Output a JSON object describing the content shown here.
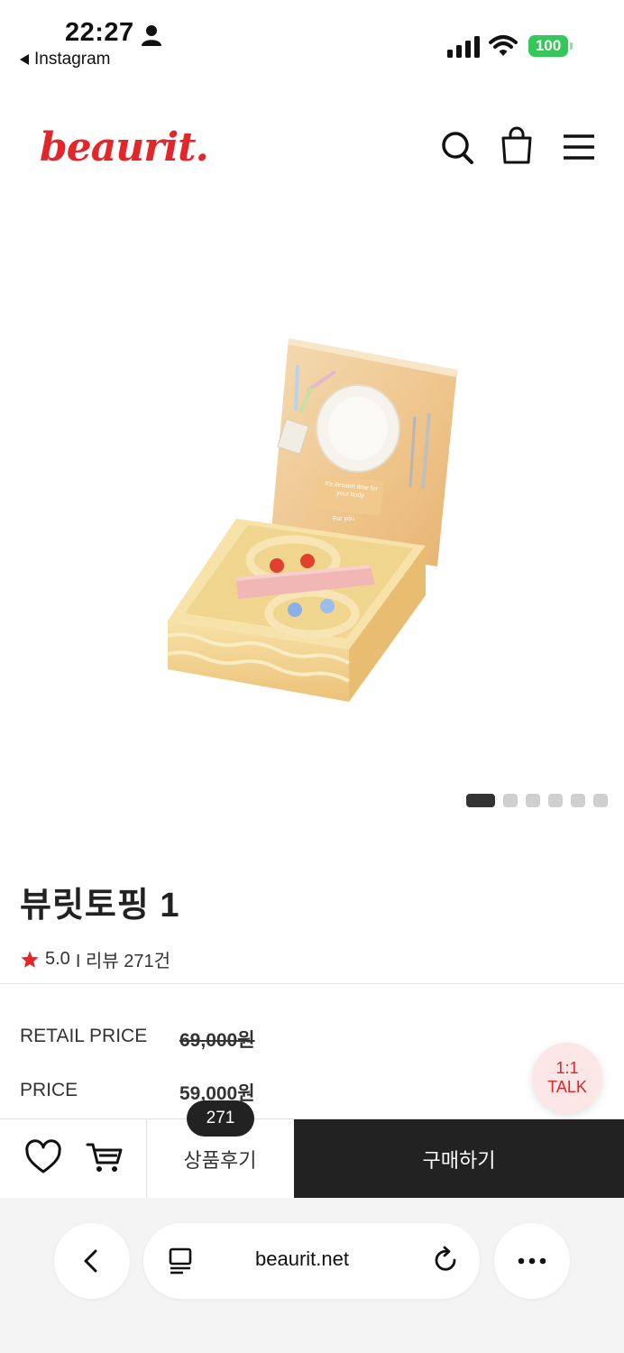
{
  "status_bar": {
    "time": "22:27",
    "back_app": "Instagram",
    "battery": "100"
  },
  "header": {
    "logo": "beaurit."
  },
  "gallery": {
    "slide_count": 6,
    "active_index": 0
  },
  "product": {
    "title": "뷰릿토핑 1",
    "rating": "5.0",
    "review_text": "I 리뷰 271건",
    "retail_price_label": "RETAIL PRICE",
    "retail_price": "69,000원",
    "price_label": "PRICE",
    "price": "59,000원",
    "box_text": "It's dessert time for your body",
    "box_signature": "For you"
  },
  "talk": {
    "line1": "1:1",
    "line2": "TALK"
  },
  "action_bar": {
    "review_count": "271",
    "review_label": "상품후기",
    "buy_label": "구매하기"
  },
  "browser": {
    "url": "beaurit.net"
  },
  "colors": {
    "brand": "#e2262a",
    "dark": "#222222",
    "battery": "#34c759"
  }
}
